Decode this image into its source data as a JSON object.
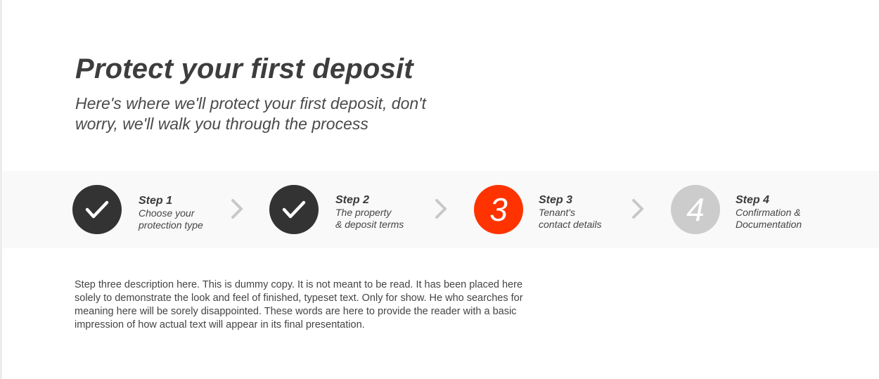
{
  "header": {
    "title": "Protect your first deposit",
    "subtitle": "Here's where we'll protect your first deposit, don't worry, we'll walk you through the process"
  },
  "steps": [
    {
      "title": "Step 1",
      "line1": "Choose your",
      "line2": "protection type",
      "status": "completed",
      "icon": "checkmark-icon"
    },
    {
      "title": "Step 2",
      "line1": "The property",
      "line2": "& deposit terms",
      "status": "completed",
      "icon": "checkmark-icon"
    },
    {
      "title": "Step 3",
      "line1": "Tenant's",
      "line2": "contact details",
      "status": "active",
      "number": "3"
    },
    {
      "title": "Step 4",
      "line1": "Confirmation &",
      "line2": "Documentation",
      "status": "pending",
      "number": "4"
    }
  ],
  "separator_icon": "chevron-right-icon",
  "description": "Step three description here. This is dummy copy. It is not meant to be read. It has been placed here solely to demonstrate the look and feel of finished, typeset text. Only for show. He who searches for meaning here will be sorely disappointed.  These words are here to provide the reader with a basic impression of how actual text will appear in its final presentation.",
  "colors": {
    "completed": "#333333",
    "active": "#fe3300",
    "pending": "#cccccc",
    "bar_background": "#f9f9f9",
    "chevron": "#c8c8c8"
  }
}
